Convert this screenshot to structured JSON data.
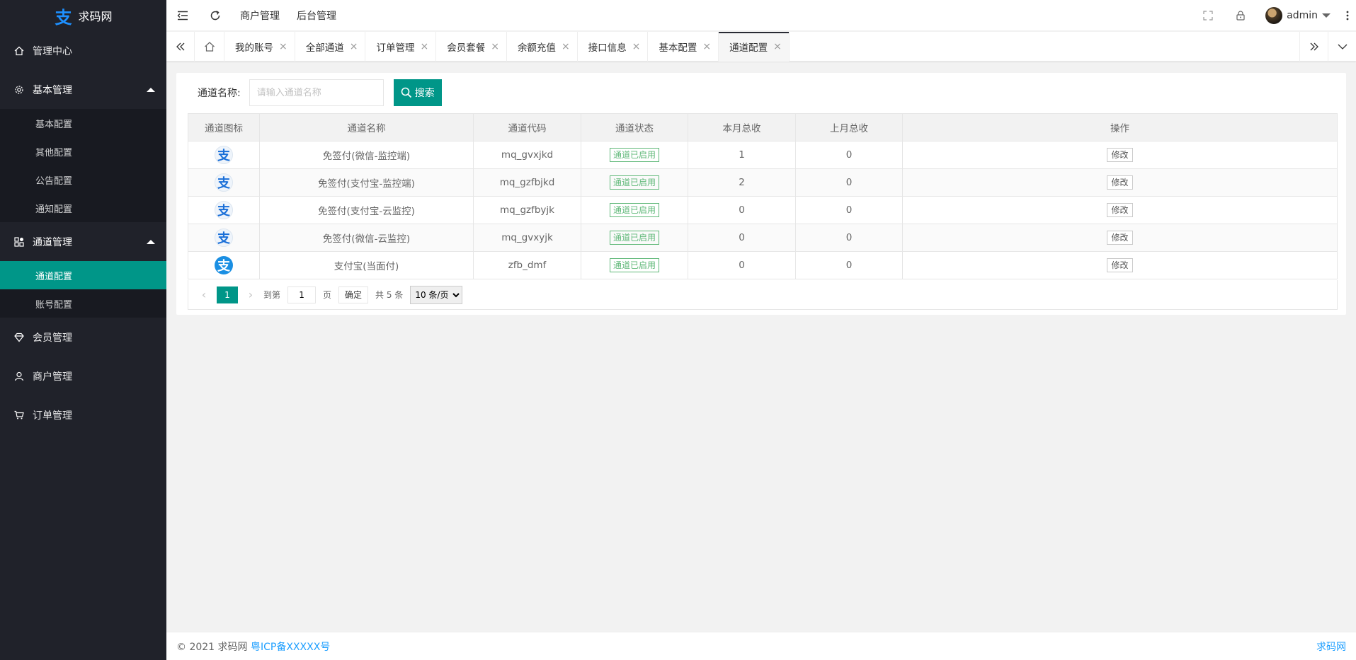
{
  "brand": {
    "name": "求码网",
    "logo_icon": "alipay-zhi-logo",
    "color": "#1e90ff"
  },
  "sidebar": {
    "items": [
      {
        "label": "管理中心",
        "icon": "home-icon"
      },
      {
        "label": "基本管理",
        "icon": "gear-icon",
        "children": [
          "基本配置",
          "其他配置",
          "公告配置",
          "通知配置"
        ]
      },
      {
        "label": "通道管理",
        "icon": "apps-icon",
        "children": [
          "通道配置",
          "账号配置"
        ],
        "active_child": "通道配置"
      },
      {
        "label": "会员管理",
        "icon": "diamond-icon"
      },
      {
        "label": "商户管理",
        "icon": "user-icon"
      },
      {
        "label": "订单管理",
        "icon": "cart-icon"
      }
    ]
  },
  "header": {
    "links": [
      "商户管理",
      "后台管理"
    ],
    "user": "admin"
  },
  "tabs": {
    "items": [
      "我的账号",
      "全部通道",
      "订单管理",
      "会员套餐",
      "余额充值",
      "接口信息",
      "基本配置",
      "通道配置"
    ],
    "active": "通道配置"
  },
  "search": {
    "label": "通道名称:",
    "placeholder": "请输入通道名称",
    "button": "搜索"
  },
  "table": {
    "headers": [
      "通道图标",
      "通道名称",
      "通道代码",
      "通道状态",
      "本月总收",
      "上月总收",
      "操作"
    ],
    "rows": [
      {
        "icon": "alipay-light",
        "name": "免签付(微信-监控端)",
        "code": "mq_gvxjkd",
        "status": "通道已启用",
        "this_month": "1",
        "last_month": "0",
        "action": "修改"
      },
      {
        "icon": "alipay-light",
        "name": "免签付(支付宝-监控端)",
        "code": "mq_gzfbjkd",
        "status": "通道已启用",
        "this_month": "2",
        "last_month": "0",
        "action": "修改"
      },
      {
        "icon": "alipay-light",
        "name": "免签付(支付宝-云监控)",
        "code": "mq_gzfbyjk",
        "status": "通道已启用",
        "this_month": "0",
        "last_month": "0",
        "action": "修改"
      },
      {
        "icon": "alipay-light",
        "name": "免签付(微信-云监控)",
        "code": "mq_gvxyjk",
        "status": "通道已启用",
        "this_month": "0",
        "last_month": "0",
        "action": "修改"
      },
      {
        "icon": "alipay-solid",
        "name": "支付宝(当面付)",
        "code": "zfb_dmf",
        "status": "通道已启用",
        "this_month": "0",
        "last_month": "0",
        "action": "修改"
      }
    ]
  },
  "pager": {
    "current": "1",
    "goto_label": "到第",
    "goto_value": "1",
    "page_label": "页",
    "confirm": "确定",
    "total": "共 5 条",
    "page_size": "10 条/页"
  },
  "footer": {
    "copyright": "© 2021 求码网",
    "icp": "粤ICP备XXXXX号",
    "right": "求码网"
  },
  "colors": {
    "accent": "#009688",
    "sidebar_bg": "#20222a",
    "status_green": "#5fb878",
    "link": "#1e9fff"
  }
}
